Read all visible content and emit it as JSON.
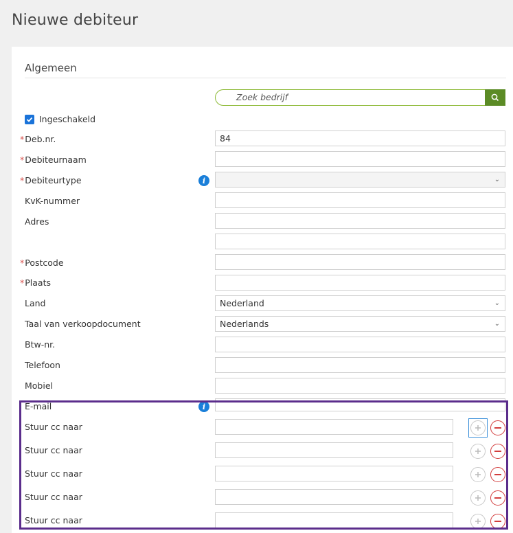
{
  "page_title": "Nieuwe debiteur",
  "section": {
    "title": "Algemeen"
  },
  "search": {
    "placeholder": "Zoek bedrijf",
    "icon": "search-icon"
  },
  "enabled": {
    "label": "Ingeschakeld",
    "checked": true
  },
  "fields": {
    "debnr": {
      "label": "Deb.nr.",
      "value": "84",
      "required": true
    },
    "debiteurnaam": {
      "label": "Debiteurnaam",
      "value": "",
      "required": true
    },
    "debiteurtype": {
      "label": "Debiteurtype",
      "value": "",
      "required": true
    },
    "kvk": {
      "label": "KvK-nummer",
      "value": ""
    },
    "adres": {
      "label": "Adres",
      "value": "",
      "value2": ""
    },
    "postcode": {
      "label": "Postcode",
      "value": "",
      "required": true
    },
    "plaats": {
      "label": "Plaats",
      "value": "",
      "required": true
    },
    "land": {
      "label": "Land",
      "value": "Nederland"
    },
    "taal": {
      "label": "Taal van verkoopdocument",
      "value": "Nederlands"
    },
    "btw": {
      "label": "Btw-nr.",
      "value": ""
    },
    "telefoon": {
      "label": "Telefoon",
      "value": ""
    },
    "mobiel": {
      "label": "Mobiel",
      "value": ""
    },
    "email": {
      "label": "E-mail",
      "value": ""
    }
  },
  "cc_rows": [
    {
      "label": "Stuur cc naar",
      "value": ""
    },
    {
      "label": "Stuur cc naar",
      "value": ""
    },
    {
      "label": "Stuur cc naar",
      "value": ""
    },
    {
      "label": "Stuur cc naar",
      "value": ""
    },
    {
      "label": "Stuur cc naar",
      "value": ""
    }
  ],
  "required_marker": "*",
  "colors": {
    "accent_green": "#5b8b25",
    "required_red": "#d9534f",
    "info_blue": "#1a7fd9",
    "highlight_purple": "#5b2d8c"
  }
}
